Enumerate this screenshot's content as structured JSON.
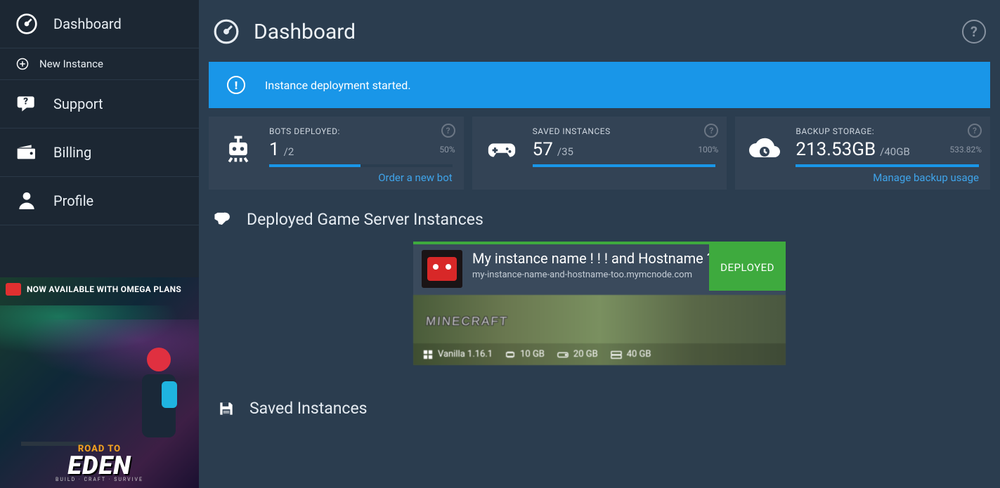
{
  "sidebar": {
    "items": [
      {
        "label": "Dashboard"
      },
      {
        "label": "New Instance"
      },
      {
        "label": "Support"
      },
      {
        "label": "Billing"
      },
      {
        "label": "Profile"
      }
    ],
    "promo": {
      "banner": "NOW AVAILABLE WITH OMEGA PLANS",
      "roadto": "ROAD TO",
      "title": "EDEN",
      "tagline": "BUILD · CRAFT · SURVIVE"
    }
  },
  "header": {
    "title": "Dashboard"
  },
  "alert": {
    "text": "Instance deployment started."
  },
  "stats": {
    "bots": {
      "label": "BOTS DEPLOYED:",
      "num": "1",
      "denom": "/2",
      "pct": "50%",
      "fill": 50,
      "link": "Order a new bot"
    },
    "saved": {
      "label": "SAVED INSTANCES",
      "num": "57",
      "denom": "/35",
      "pct": "100%",
      "fill": 100
    },
    "backup": {
      "label": "BACKUP STORAGE:",
      "num": "213.53GB",
      "denom": "/40GB",
      "pct": "533.82%",
      "fill": 100,
      "link": "Manage backup usage"
    }
  },
  "sections": {
    "deployed": "Deployed Game Server Instances",
    "saved": "Saved Instances"
  },
  "instance": {
    "name": "My instance name ! ! ! and Hostname ? ?",
    "host": "my-instance-name-and-hostname-too.mymcnode.com",
    "status": "DEPLOYED",
    "game": "MINECRAFT",
    "meta": {
      "version": "Vanilla 1.16.1",
      "ram": "10 GB",
      "disk1": "20 GB",
      "disk2": "40 GB"
    }
  }
}
